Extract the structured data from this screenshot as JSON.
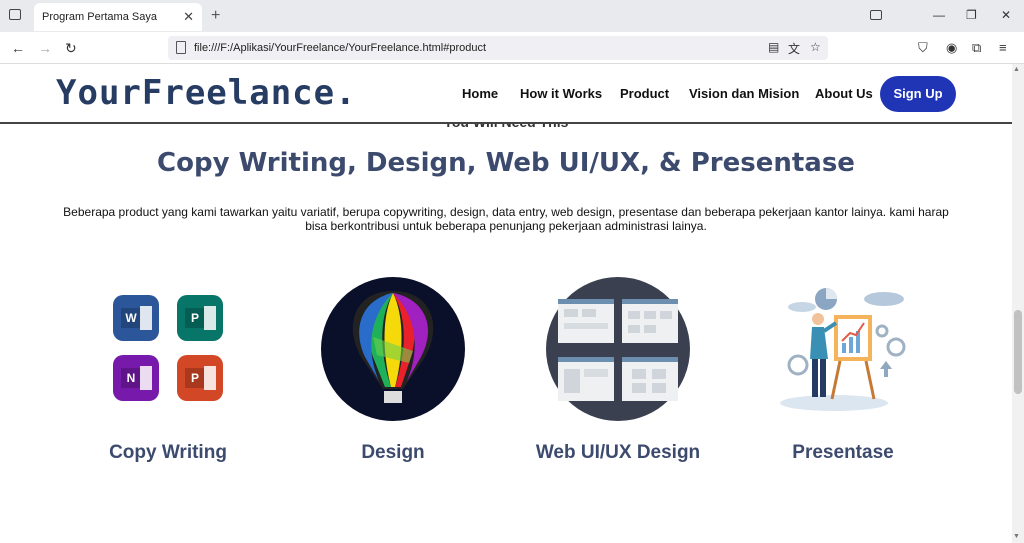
{
  "browser": {
    "tab_title": "Program Pertama Saya",
    "url": "file:///F:/Aplikasi/YourFreelance/YourFreelance.html#product"
  },
  "site": {
    "logo": "YourFreelance.",
    "nav": [
      "Home",
      "How it Works",
      "Product",
      "Vision dan Mision",
      "About Us"
    ],
    "signup": "Sign Up"
  },
  "section": {
    "eyebrow": "You Will Need This",
    "title": "Copy Writing, Design, Web UI/UX, & Presentase",
    "description": "Beberapa product yang kami tawarkan yaitu variatif, berupa copywriting, design, data entry, web design, presentase dan beberapa pekerjaan kantor lainya. kami harap bisa berkontribusi untuk beberapa penunjang pekerjaan administrasi lainya."
  },
  "cards": [
    {
      "title": "Copy Writing",
      "icon": "office-apps-icon"
    },
    {
      "title": "Design",
      "icon": "coreldraw-balloon-icon"
    },
    {
      "title": "Web UI/UX Design",
      "icon": "wireframe-icon"
    },
    {
      "title": "Presentase",
      "icon": "presentation-illustration-icon"
    }
  ],
  "office_letters": [
    "W",
    "P",
    "N",
    "P"
  ],
  "colors": {
    "brand": "#263c63",
    "signup": "#1f35b6",
    "word": "#2b579a",
    "publisher": "#077568",
    "onenote": "#7719aa",
    "powerpoint": "#d24726"
  }
}
